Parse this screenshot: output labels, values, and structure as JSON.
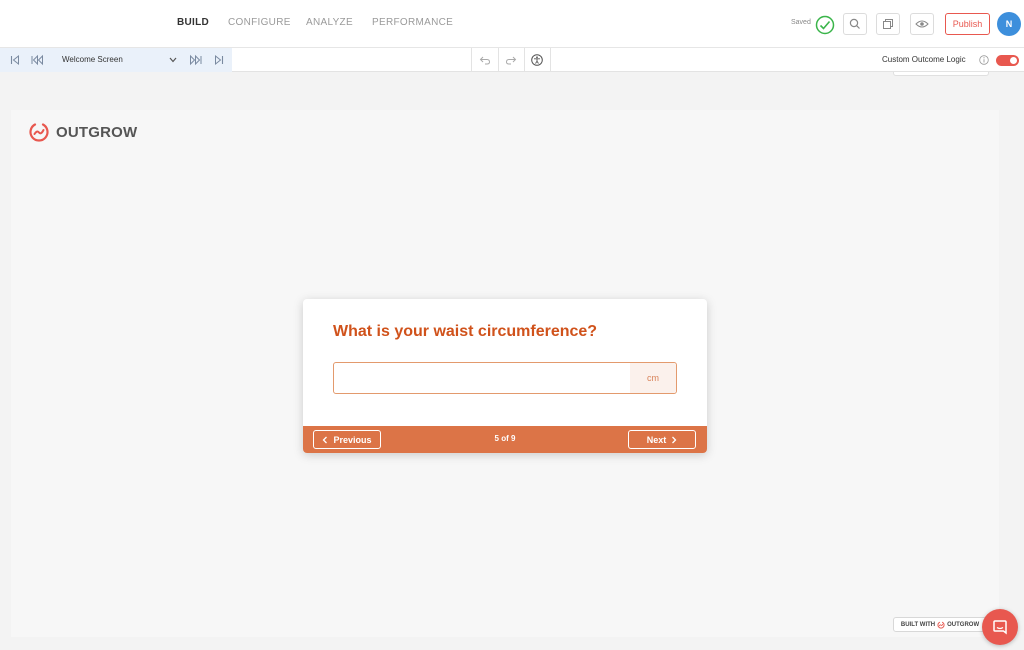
{
  "nav": {
    "tabs": [
      {
        "label": "BUILD",
        "active": true
      },
      {
        "label": "CONFIGURE",
        "active": false
      },
      {
        "label": "ANALYZE",
        "active": false
      },
      {
        "label": "PERFORMANCE",
        "active": false
      }
    ],
    "saved_label": "Saved",
    "publish_label": "Publish",
    "avatar_initial": "N"
  },
  "toolbar": {
    "screen_select_value": "Welcome Screen",
    "custom_outcome_label": "Custom Outcome Logic",
    "custom_outcome_enabled": true
  },
  "canvas": {
    "logo_text": "OUTGROW",
    "question": "What is your waist circumference?",
    "answer_value": "",
    "unit": "cm",
    "previous_label": "Previous",
    "next_label": "Next",
    "progress": "5 of 9",
    "built_with": "BUILT WITH",
    "built_brand": "OUTGROW"
  },
  "colors": {
    "accent": "#e8584f",
    "question": "#d0521b",
    "footer_bar": "#dc7447"
  }
}
